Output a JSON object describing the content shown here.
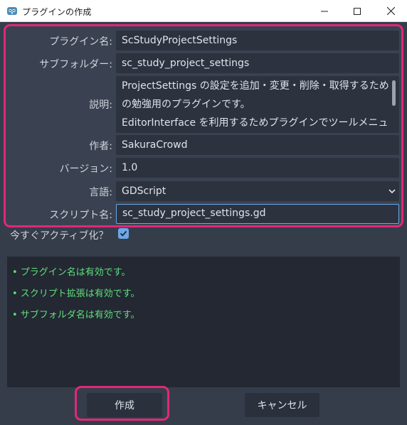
{
  "window": {
    "title": "プラグインの作成",
    "icon": "godot-icon"
  },
  "form": {
    "plugin_name": {
      "label": "プラグイン名:",
      "value": "ScStudyProjectSettings"
    },
    "subfolder": {
      "label": "サブフォルダー:",
      "value": "sc_study_project_settings"
    },
    "description": {
      "label": "説明:",
      "lines": [
        "ProjectSettings の設定を追加・変更・削除・取得するため",
        "の勉強用のプラグインです。",
        "EditorInterface を利用するためプラグインでツールメニュ"
      ]
    },
    "author": {
      "label": "作者:",
      "value": "SakuraCrowd"
    },
    "version": {
      "label": "バージョン:",
      "value": "1.0"
    },
    "language": {
      "label": "言語:",
      "value": "GDScript"
    },
    "script_name": {
      "label": "スクリプト名:",
      "value": "sc_study_project_settings.gd"
    }
  },
  "activate": {
    "label": "今すぐアクティブ化？",
    "checked": true
  },
  "messages": [
    "•  プラグイン名は有効です。",
    "•  スクリプト拡張は有効です。",
    "•  サブフォルダ名は有効です。"
  ],
  "buttons": {
    "create": "作成",
    "cancel": "キャンセル"
  },
  "colors": {
    "highlight": "#e0287a",
    "valid": "#5fe07a",
    "accent": "#6ea7e8"
  }
}
